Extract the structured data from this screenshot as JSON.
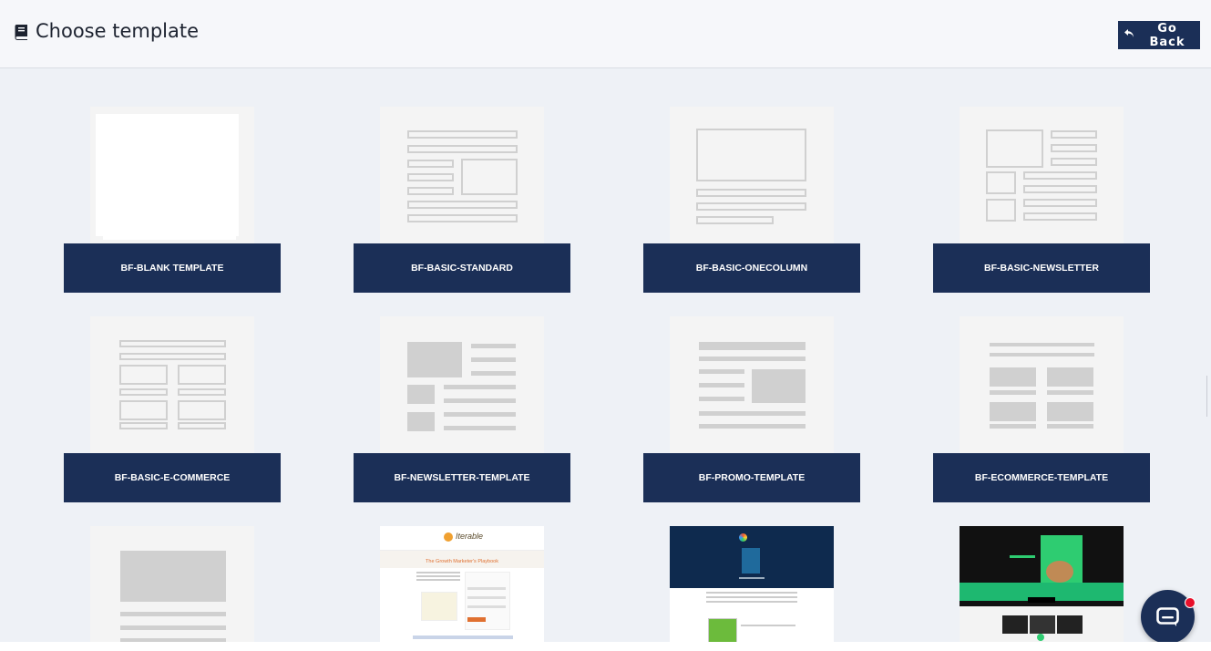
{
  "header": {
    "title": "Choose template",
    "title_icon": "book-icon",
    "go_back_label": "Go Back",
    "go_back_icon": "reply-arrow-icon"
  },
  "templates": [
    {
      "label": "BF-BLANK TEMPLATE"
    },
    {
      "label": "BF-BASIC-STANDARD"
    },
    {
      "label": "BF-BASIC-ONECOLUMN"
    },
    {
      "label": "BF-BASIC-NEWSLETTER"
    },
    {
      "label": "BF-BASIC-E-COMMERCE"
    },
    {
      "label": "BF-NEWSLETTER-TEMPLATE"
    },
    {
      "label": "BF-PROMO-TEMPLATE"
    },
    {
      "label": "BF-ECOMMERCE-TEMPLATE"
    }
  ],
  "preview_texts": {
    "growth_title": "The Growth Marketer's Playbook",
    "growth_brand": "Iterable"
  },
  "chat": {
    "icon": "chat-bubble-icon"
  },
  "colors": {
    "accent": "#1b2f57",
    "background": "#eef1f6",
    "notification": "#e8102b"
  }
}
